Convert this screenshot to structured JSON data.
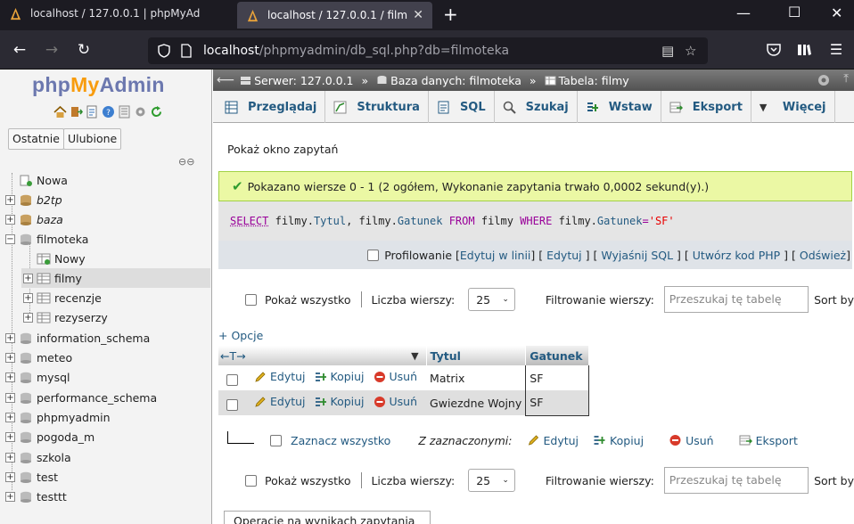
{
  "browser": {
    "tabs": [
      {
        "title": "localhost / 127.0.0.1 | phpMyAd"
      },
      {
        "title": "localhost / 127.0.0.1 / filmoteka"
      }
    ],
    "url_host": "localhost",
    "url_path": "/phpmyadmin/db_sql.php?db=filmoteka",
    "icons": [
      "back-icon",
      "forward-icon",
      "reload-icon",
      "shield-icon",
      "page-icon",
      "reader-icon",
      "star-icon",
      "pocket-icon",
      "library-icon",
      "menu-icon",
      "minimize-icon",
      "maximize-icon",
      "close-icon"
    ]
  },
  "sidebar": {
    "logo": {
      "php": "php",
      "my": "My",
      "admin": "Admin"
    },
    "recent_label": "Ostatnie",
    "favorites_label": "Ulubione",
    "tree": [
      {
        "label": "Nowa",
        "italic": false
      },
      {
        "label": "b2tp",
        "italic": true
      },
      {
        "label": "baza",
        "italic": true
      },
      {
        "label": "filmoteka",
        "italic": false
      },
      {
        "label": "Nowy",
        "italic": false
      },
      {
        "label": "filmy",
        "italic": false
      },
      {
        "label": "recenzje",
        "italic": false
      },
      {
        "label": "rezyserzy",
        "italic": false
      },
      {
        "label": "information_schema",
        "italic": false
      },
      {
        "label": "meteo",
        "italic": false
      },
      {
        "label": "mysql",
        "italic": false
      },
      {
        "label": "performance_schema",
        "italic": false
      },
      {
        "label": "phpmyadmin",
        "italic": false
      },
      {
        "label": "pogoda_m",
        "italic": false
      },
      {
        "label": "szkola",
        "italic": false
      },
      {
        "label": "test",
        "italic": false
      },
      {
        "label": "testtt",
        "italic": false
      }
    ]
  },
  "breadcrumb": {
    "server": "Serwer: 127.0.0.1",
    "database": "Baza danych: filmoteka",
    "table": "Tabela: filmy",
    "separator": "»"
  },
  "menu": {
    "tabs": [
      "Przeglądaj",
      "Struktura",
      "SQL",
      "Szukaj",
      "Wstaw",
      "Eksport",
      "Więcej"
    ]
  },
  "query": {
    "show_window_link": "Pokaż okno zapytań",
    "success_message": "Pokazano wiersze 0 - 1 (2 ogółem, Wykonanie zapytania trwało 0,0002 sekund(y).)",
    "sql_parts": {
      "select": "SELECT",
      "f1a": "filmy.",
      "f1b": "Tytul",
      "comma": ", ",
      "f2a": "filmy.",
      "f2b": "Gatunek",
      "from": "FROM",
      "table": "filmy",
      "where": "WHERE",
      "f3a": "filmy.",
      "f3b": "Gatunek",
      "eq": "=",
      "value": "'SF'"
    },
    "profiling_label": "Profilowanie",
    "links": {
      "edit_inline": "Edytuj w linii",
      "edit": "Edytuj",
      "explain": "Wyjaśnij SQL",
      "php_code": "Utwórz kod PHP",
      "refresh": "Odśwież"
    }
  },
  "nav": {
    "show_all": "Pokaż wszystko",
    "rows_label": "Liczba wierszy:",
    "rows_value": "25",
    "filter_label": "Filtrowanie wierszy:",
    "filter_placeholder": "Przeszukaj tę tabelę",
    "sort_label": "Sort by"
  },
  "options_link": "+ Opcje",
  "table": {
    "arrows": "←T→",
    "columns": [
      "Tytul",
      "Gatunek"
    ],
    "actions": {
      "edit": "Edytuj",
      "copy": "Kopiuj",
      "delete": "Usuń"
    },
    "rows": [
      {
        "Tytul": "Matrix",
        "Gatunek": "SF"
      },
      {
        "Tytul": "Gwiezdne Wojny",
        "Gatunek": "SF"
      }
    ]
  },
  "bulk": {
    "check_all": "Zaznacz wszystko",
    "with_selected": "Z zaznaczonymi:",
    "edit": "Edytuj",
    "copy": "Kopiuj",
    "delete": "Usuń",
    "export": "Eksport"
  },
  "ops_header": "Operacje na wynikach zapytania"
}
